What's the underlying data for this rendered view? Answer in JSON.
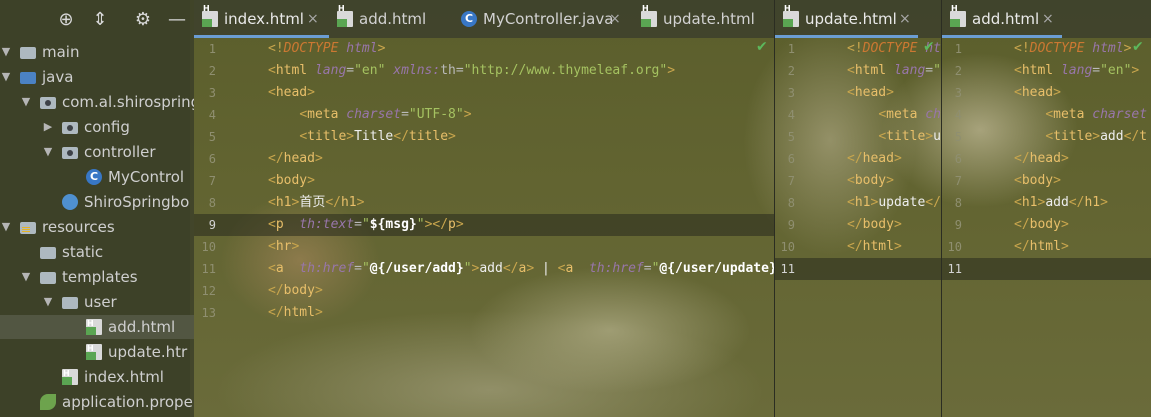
{
  "tree": {
    "toolbar": [
      "target-icon",
      "collapse-all-icon",
      "gear-icon",
      "minimize-icon"
    ],
    "items": [
      {
        "label": "main",
        "icon": "folder-icon",
        "arrow": "expanded"
      },
      {
        "label": "java",
        "icon": "source-folder-icon",
        "arrow": "expanded"
      },
      {
        "label": "com.al.shirospringb",
        "icon": "package-icon",
        "arrow": "expanded"
      },
      {
        "label": "config",
        "icon": "package-icon",
        "arrow": "collapsed"
      },
      {
        "label": "controller",
        "icon": "package-icon",
        "arrow": "expanded"
      },
      {
        "label": "MyControl",
        "icon": "java-class-icon",
        "arrow": "none"
      },
      {
        "label": "ShiroSpringbo",
        "icon": "spring-boot-app-icon",
        "arrow": "none"
      },
      {
        "label": "resources",
        "icon": "resources-folder-icon",
        "arrow": "expanded"
      },
      {
        "label": "static",
        "icon": "folder-icon",
        "arrow": "none"
      },
      {
        "label": "templates",
        "icon": "folder-icon",
        "arrow": "expanded"
      },
      {
        "label": "user",
        "icon": "folder-icon",
        "arrow": "expanded"
      },
      {
        "label": "add.html",
        "icon": "html-file-icon",
        "arrow": "none",
        "selected": true
      },
      {
        "label": "update.htr",
        "icon": "html-file-icon",
        "arrow": "none"
      },
      {
        "label": "index.html",
        "icon": "html-file-icon",
        "arrow": "none"
      },
      {
        "label": "application.prope",
        "icon": "spring-config-icon",
        "arrow": "none"
      }
    ]
  },
  "panes": [
    {
      "id": "left",
      "tabs": [
        {
          "label": "index.html",
          "icon": "html-file-icon",
          "active": true,
          "close": "×"
        },
        {
          "label": "add.html",
          "icon": "html-file-icon",
          "active": false,
          "close": ""
        },
        {
          "label": "MyController.java",
          "icon": "java-class-icon",
          "active": false,
          "close": "×"
        },
        {
          "label": "update.html",
          "icon": "html-file-icon",
          "active": false,
          "close": ""
        }
      ],
      "current_line": 9,
      "lines": [
        [
          [
            "t-br",
            "<!"
          ],
          [
            "t-kw",
            "DOCTYPE"
          ],
          [
            "t-tx",
            " "
          ],
          [
            "t-ns",
            "html"
          ],
          [
            "t-br",
            ">"
          ]
        ],
        [
          [
            "t-br",
            "<"
          ],
          [
            "t-tag",
            "html"
          ],
          [
            "t-tx",
            " "
          ],
          [
            "t-ns",
            "lang"
          ],
          [
            "t-at",
            "="
          ],
          [
            "t-str",
            "\"en\""
          ],
          [
            "t-tx",
            " "
          ],
          [
            "t-ns",
            "xmlns:"
          ],
          [
            "t-at",
            "th"
          ],
          [
            "t-at",
            "="
          ],
          [
            "t-str",
            "\"http://www.thymeleaf.org\""
          ],
          [
            "t-br",
            ">"
          ]
        ],
        [
          [
            "t-br",
            "<"
          ],
          [
            "t-tag",
            "head"
          ],
          [
            "t-br",
            ">"
          ]
        ],
        [
          [
            "t-tx",
            "    "
          ],
          [
            "t-br",
            "<"
          ],
          [
            "t-tag",
            "meta"
          ],
          [
            "t-tx",
            " "
          ],
          [
            "t-ns",
            "charset"
          ],
          [
            "t-at",
            "="
          ],
          [
            "t-str",
            "\"UTF-8\""
          ],
          [
            "t-br",
            ">"
          ]
        ],
        [
          [
            "t-tx",
            "    "
          ],
          [
            "t-br",
            "<"
          ],
          [
            "t-tag",
            "title"
          ],
          [
            "t-br",
            ">"
          ],
          [
            "t-tx",
            "Title"
          ],
          [
            "t-br",
            "</"
          ],
          [
            "t-tag",
            "title"
          ],
          [
            "t-br",
            ">"
          ]
        ],
        [
          [
            "t-br",
            "</"
          ],
          [
            "t-tag",
            "head"
          ],
          [
            "t-br",
            ">"
          ]
        ],
        [
          [
            "t-br",
            "<"
          ],
          [
            "t-tag",
            "body"
          ],
          [
            "t-br",
            ">"
          ]
        ],
        [
          [
            "t-br",
            "<"
          ],
          [
            "t-tag",
            "h1"
          ],
          [
            "t-br",
            ">"
          ],
          [
            "t-tx",
            "首页"
          ],
          [
            "t-br",
            "</"
          ],
          [
            "t-tag",
            "h1"
          ],
          [
            "t-br",
            ">"
          ]
        ],
        [
          [
            "t-br",
            "<"
          ],
          [
            "t-tag",
            "p"
          ],
          [
            "t-tx",
            "  "
          ],
          [
            "t-ns",
            "th:text"
          ],
          [
            "t-at",
            "="
          ],
          [
            "t-str",
            "\""
          ],
          [
            "t-ex",
            "${msg}"
          ],
          [
            "t-str",
            "\""
          ],
          [
            "t-br",
            "></"
          ],
          [
            "t-tag",
            "p"
          ],
          [
            "t-br",
            ">"
          ]
        ],
        [
          [
            "t-br",
            "<"
          ],
          [
            "t-tag",
            "hr"
          ],
          [
            "t-br",
            ">"
          ]
        ],
        [
          [
            "t-br",
            "<"
          ],
          [
            "t-tag",
            "a"
          ],
          [
            "t-tx",
            "  "
          ],
          [
            "t-ns",
            "th:href"
          ],
          [
            "t-at",
            "="
          ],
          [
            "t-str",
            "\""
          ],
          [
            "t-ex",
            "@{/user/add}"
          ],
          [
            "t-str",
            "\""
          ],
          [
            "t-br",
            ">"
          ],
          [
            "t-tx",
            "add"
          ],
          [
            "t-br",
            "</"
          ],
          [
            "t-tag",
            "a"
          ],
          [
            "t-br",
            ">"
          ],
          [
            "t-tx",
            " | "
          ],
          [
            "t-br",
            "<"
          ],
          [
            "t-tag",
            "a"
          ],
          [
            "t-tx",
            "  "
          ],
          [
            "t-ns",
            "th:href"
          ],
          [
            "t-at",
            "="
          ],
          [
            "t-str",
            "\""
          ],
          [
            "t-ex",
            "@{/user/update}"
          ]
        ],
        [
          [
            "t-br",
            "</"
          ],
          [
            "t-tag",
            "body"
          ],
          [
            "t-br",
            ">"
          ]
        ],
        [
          [
            "t-br",
            "</"
          ],
          [
            "t-tag",
            "html"
          ],
          [
            "t-br",
            ">"
          ]
        ]
      ]
    },
    {
      "id": "middle",
      "tabs": [
        {
          "label": "update.html",
          "icon": "html-file-icon",
          "active": true,
          "close": "×"
        }
      ],
      "current_line": 11,
      "lines": [
        [
          [
            "t-br",
            "<!"
          ],
          [
            "t-kw",
            "DOCTYPE"
          ],
          [
            "t-tx",
            " "
          ],
          [
            "t-ns",
            "ht"
          ]
        ],
        [
          [
            "t-br",
            "<"
          ],
          [
            "t-tag",
            "html"
          ],
          [
            "t-tx",
            " "
          ],
          [
            "t-ns",
            "lang"
          ],
          [
            "t-at",
            "="
          ],
          [
            "t-str",
            "\""
          ]
        ],
        [
          [
            "t-br",
            "<"
          ],
          [
            "t-tag",
            "head"
          ],
          [
            "t-br",
            ">"
          ]
        ],
        [
          [
            "t-tx",
            "    "
          ],
          [
            "t-br",
            "<"
          ],
          [
            "t-tag",
            "meta"
          ],
          [
            "t-tx",
            " "
          ],
          [
            "t-ns",
            "ch"
          ]
        ],
        [
          [
            "t-tx",
            "    "
          ],
          [
            "t-br",
            "<"
          ],
          [
            "t-tag",
            "title"
          ],
          [
            "t-br",
            ">"
          ],
          [
            "t-tx",
            "u"
          ]
        ],
        [
          [
            "t-br",
            "</"
          ],
          [
            "t-tag",
            "head"
          ],
          [
            "t-br",
            ">"
          ]
        ],
        [
          [
            "t-br",
            "<"
          ],
          [
            "t-tag",
            "body"
          ],
          [
            "t-br",
            ">"
          ]
        ],
        [
          [
            "t-br",
            "<"
          ],
          [
            "t-tag",
            "h1"
          ],
          [
            "t-br",
            ">"
          ],
          [
            "t-tx",
            "update"
          ],
          [
            "t-br",
            "</"
          ]
        ],
        [
          [
            "t-br",
            "</"
          ],
          [
            "t-tag",
            "body"
          ],
          [
            "t-br",
            ">"
          ]
        ],
        [
          [
            "t-br",
            "</"
          ],
          [
            "t-tag",
            "html"
          ],
          [
            "t-br",
            ">"
          ]
        ],
        []
      ]
    },
    {
      "id": "right",
      "tabs": [
        {
          "label": "add.html",
          "icon": "html-file-icon",
          "active": true,
          "close": "×"
        }
      ],
      "current_line": 11,
      "lines": [
        [
          [
            "t-br",
            "<!"
          ],
          [
            "t-kw",
            "DOCTYPE"
          ],
          [
            "t-tx",
            " "
          ],
          [
            "t-ns",
            "html"
          ],
          [
            "t-br",
            ">"
          ]
        ],
        [
          [
            "t-br",
            "<"
          ],
          [
            "t-tag",
            "html"
          ],
          [
            "t-tx",
            " "
          ],
          [
            "t-ns",
            "lang"
          ],
          [
            "t-at",
            "="
          ],
          [
            "t-str",
            "\"en\""
          ],
          [
            "t-br",
            ">"
          ]
        ],
        [
          [
            "t-br",
            "<"
          ],
          [
            "t-tag",
            "head"
          ],
          [
            "t-br",
            ">"
          ]
        ],
        [
          [
            "t-tx",
            "    "
          ],
          [
            "t-br",
            "<"
          ],
          [
            "t-tag",
            "meta"
          ],
          [
            "t-tx",
            " "
          ],
          [
            "t-ns",
            "charset"
          ]
        ],
        [
          [
            "t-tx",
            "    "
          ],
          [
            "t-br",
            "<"
          ],
          [
            "t-tag",
            "title"
          ],
          [
            "t-br",
            ">"
          ],
          [
            "t-tx",
            "add"
          ],
          [
            "t-br",
            "</"
          ],
          [
            "t-tag",
            "t"
          ]
        ],
        [
          [
            "t-br",
            "</"
          ],
          [
            "t-tag",
            "head"
          ],
          [
            "t-br",
            ">"
          ]
        ],
        [
          [
            "t-br",
            "<"
          ],
          [
            "t-tag",
            "body"
          ],
          [
            "t-br",
            ">"
          ]
        ],
        [
          [
            "t-br",
            "<"
          ],
          [
            "t-tag",
            "h1"
          ],
          [
            "t-br",
            ">"
          ],
          [
            "t-tx",
            "add"
          ],
          [
            "t-br",
            "</"
          ],
          [
            "t-tag",
            "h1"
          ],
          [
            "t-br",
            ">"
          ]
        ],
        [
          [
            "t-br",
            "</"
          ],
          [
            "t-tag",
            "body"
          ],
          [
            "t-br",
            ">"
          ]
        ],
        [
          [
            "t-br",
            "</"
          ],
          [
            "t-tag",
            "html"
          ],
          [
            "t-br",
            ">"
          ]
        ],
        []
      ]
    }
  ],
  "colors": {
    "accent": "#6b9dd3",
    "check": "#5cb85c",
    "tag": "#e8bf6a",
    "string": "#a5c261",
    "attribute": "#9876aa"
  }
}
